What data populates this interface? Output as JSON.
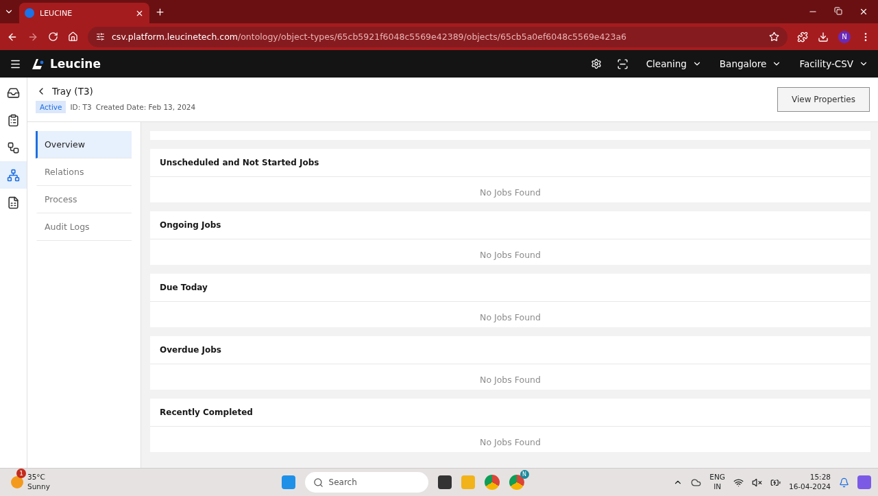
{
  "browser": {
    "tab": {
      "title": "LEUCINE",
      "selected": true
    },
    "url_host": "csv.platform.leucinetech.com",
    "url_path": "/ontology/object-types/65cb5921f6048c5569e42389/objects/65cb5a0ef6048c5569e423a6",
    "profile": "N"
  },
  "header": {
    "brand": "Leucine",
    "selectors": [
      "Cleaning",
      "Bangalore",
      "Facility-CSV"
    ]
  },
  "rail": [
    {
      "kind": "inbox",
      "selected": false
    },
    {
      "kind": "clipboard",
      "selected": false
    },
    {
      "kind": "flow",
      "selected": false
    },
    {
      "kind": "hierarchy",
      "selected": true
    },
    {
      "kind": "report",
      "selected": false
    }
  ],
  "object": {
    "title": "Tray (T3)",
    "status": "Active",
    "id": "ID: T3",
    "created": "Created Date: Feb 13, 2024",
    "action": "View Properties"
  },
  "nav": [
    {
      "label": "Overview",
      "selected": true
    },
    {
      "label": "Relations",
      "selected": false
    },
    {
      "label": "Process",
      "selected": false
    },
    {
      "label": "Audit Logs",
      "selected": false
    }
  ],
  "sections": [
    {
      "title": "Unscheduled and Not Started Jobs",
      "empty": "No Jobs Found"
    },
    {
      "title": "Ongoing Jobs",
      "empty": "No Jobs Found"
    },
    {
      "title": "Due Today",
      "empty": "No Jobs Found"
    },
    {
      "title": "Overdue Jobs",
      "empty": "No Jobs Found"
    },
    {
      "title": "Recently Completed",
      "empty": "No Jobs Found"
    }
  ],
  "taskbar": {
    "weather_badge": "1",
    "temperature": "35°C",
    "condition": "Sunny",
    "search": "Search",
    "language": "ENG",
    "region": "IN",
    "time": "15:28",
    "date": "16-04-2024",
    "chrome_badge": "N"
  }
}
